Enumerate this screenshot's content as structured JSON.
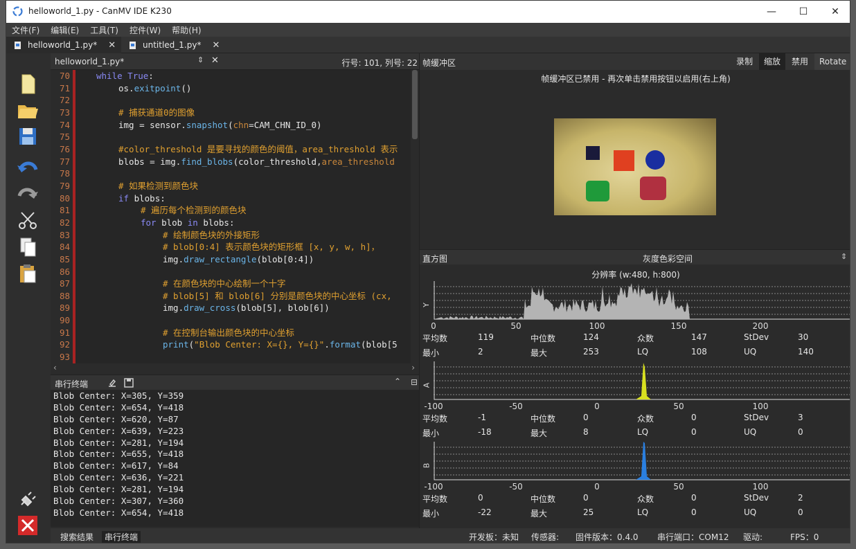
{
  "window": {
    "title": "helloworld_1.py - CanMV IDE K230",
    "minimize": "—",
    "maximize": "☐",
    "close": "✕"
  },
  "menu": [
    "文件(F)",
    "编辑(E)",
    "工具(T)",
    "控件(W)",
    "帮助(H)"
  ],
  "file_tabs": [
    {
      "label": "helloworld_1.py*"
    },
    {
      "label": "untitled_1.py*"
    }
  ],
  "toolbar": {
    "icons": [
      "new-file-icon",
      "open-folder-icon",
      "save-icon",
      "undo-icon",
      "redo-icon",
      "cut-icon",
      "copy-icon",
      "paste-icon",
      "connect-icon",
      "disconnect-icon"
    ]
  },
  "editor": {
    "filename": "helloworld_1.py*",
    "position": "行号: 101, 列号: 22",
    "lines": [
      {
        "n": "70",
        "html": "<span class='kw'>while</span> <span class='kw'>True</span>:",
        "indent": 4
      },
      {
        "n": "71",
        "html": "os.<span class='fnc'>exitpoint</span>()",
        "indent": 8
      },
      {
        "n": "72",
        "html": "",
        "indent": 8
      },
      {
        "n": "73",
        "html": "<span class='cm'># 捕获通道0的图像</span>",
        "indent": 8
      },
      {
        "n": "74",
        "html": "img = sensor.<span class='fnc'>snapshot</span>(<span class='pr'>chn</span>=CAM_CHN_ID_0)",
        "indent": 8
      },
      {
        "n": "75",
        "html": "",
        "indent": 8
      },
      {
        "n": "76",
        "html": "<span class='cm'>#color_threshold 是要寻找的颜色的阈值，area_threshold 表示</span>",
        "indent": 8
      },
      {
        "n": "77",
        "html": "blobs = img.<span class='fnc'>find_blobs</span>(color_threshold,<span class='pr'>area_threshold</span>",
        "indent": 8
      },
      {
        "n": "78",
        "html": "",
        "indent": 8
      },
      {
        "n": "79",
        "html": "<span class='cm'># 如果检测到颜色块</span>",
        "indent": 8
      },
      {
        "n": "80",
        "html": "<span class='kw'>if</span> blobs:",
        "indent": 8
      },
      {
        "n": "81",
        "html": "<span class='cm'># 遍历每个检测到的颜色块</span>",
        "indent": 12
      },
      {
        "n": "82",
        "html": "<span class='kw'>for</span> blob <span class='kw'>in</span> blobs:",
        "indent": 12
      },
      {
        "n": "83",
        "html": "<span class='cm'># 绘制颜色块的外接矩形</span>",
        "indent": 16
      },
      {
        "n": "84",
        "html": "<span class='cm'># blob[0:4] 表示颜色块的矩形框 [x, y, w, h]，</span>",
        "indent": 16
      },
      {
        "n": "85",
        "html": "img.<span class='fnc'>draw_rectangle</span>(blob[0:4])",
        "indent": 16
      },
      {
        "n": "86",
        "html": "",
        "indent": 16
      },
      {
        "n": "87",
        "html": "<span class='cm'># 在颜色块的中心绘制一个十字</span>",
        "indent": 16
      },
      {
        "n": "88",
        "html": "<span class='cm'># blob[5] 和 blob[6] 分别是颜色块的中心坐标 (cx,</span>",
        "indent": 16
      },
      {
        "n": "89",
        "html": "img.<span class='fnc'>draw_cross</span>(blob[5], blob[6])",
        "indent": 16
      },
      {
        "n": "90",
        "html": "",
        "indent": 16
      },
      {
        "n": "91",
        "html": "<span class='cm'># 在控制台输出颜色块的中心坐标</span>",
        "indent": 16
      },
      {
        "n": "92",
        "html": "<span class='fnc'>print</span>(<span class='st'>\"Blob Center: X={}, Y={}\"</span>.<span class='fnc'>format</span>(blob[5",
        "indent": 16
      },
      {
        "n": "93",
        "html": "",
        "indent": 16
      }
    ]
  },
  "serial": {
    "title": "串行终端",
    "lines": [
      "Blob Center: X=305, Y=359",
      "Blob Center: X=654, Y=418",
      "Blob Center: X=620, Y=87",
      "Blob Center: X=639, Y=223",
      "Blob Center: X=281, Y=194",
      "Blob Center: X=655, Y=418",
      "Blob Center: X=617, Y=84",
      "Blob Center: X=636, Y=221",
      "Blob Center: X=281, Y=194",
      "Blob Center: X=307, Y=360",
      "Blob Center: X=654, Y=418"
    ]
  },
  "framebuffer": {
    "title": "帧缓冲区",
    "buttons": [
      "录制",
      "缩放",
      "禁用",
      "Rotate"
    ],
    "message": "帧缓冲区已禁用 - 再次单击禁用按钮以启用(右上角)"
  },
  "histogram": {
    "title": "直方图",
    "colorspace": "灰度色彩空间",
    "resolution": "分辨率 (w:480, h:800)",
    "channels": [
      {
        "label": "Y",
        "ticks": [
          "0",
          "50",
          "100",
          "150",
          "200"
        ],
        "row1": [
          "平均数",
          "119",
          "中位数",
          "124",
          "众数",
          "147",
          "StDev",
          "30"
        ],
        "row2": [
          "最小",
          "2",
          "最大",
          "253",
          "LQ",
          "108",
          "UQ",
          "140"
        ]
      },
      {
        "label": "A",
        "ticks": [
          "-100",
          "-50",
          "0",
          "50",
          "100"
        ],
        "row1": [
          "平均数",
          "-1",
          "中位数",
          "0",
          "众数",
          "0",
          "StDev",
          "3"
        ],
        "row2": [
          "最小",
          "-18",
          "最大",
          "8",
          "LQ",
          "0",
          "UQ",
          "0"
        ]
      },
      {
        "label": "B",
        "ticks": [
          "-100",
          "-50",
          "0",
          "50",
          "100"
        ],
        "row1": [
          "平均数",
          "0",
          "中位数",
          "0",
          "众数",
          "0",
          "StDev",
          "2"
        ],
        "row2": [
          "最小",
          "-22",
          "最大",
          "25",
          "LQ",
          "0",
          "UQ",
          "0"
        ]
      }
    ]
  },
  "bottom_tabs": [
    "搜索结果",
    "串行终端"
  ],
  "status": {
    "board": "开发板：未知",
    "sensor": "传感器:",
    "firmware": "固件版本：0.4.0",
    "port": "串行端口：COM12",
    "driver": "驱动:",
    "fps": "FPS：0"
  },
  "colors": {
    "accent": "#3a7bd5",
    "error_bar": "#a82222",
    "y_hist": "#b4b4b4",
    "a_hist": "#d8e020",
    "b_hist": "#2a7fe0"
  }
}
